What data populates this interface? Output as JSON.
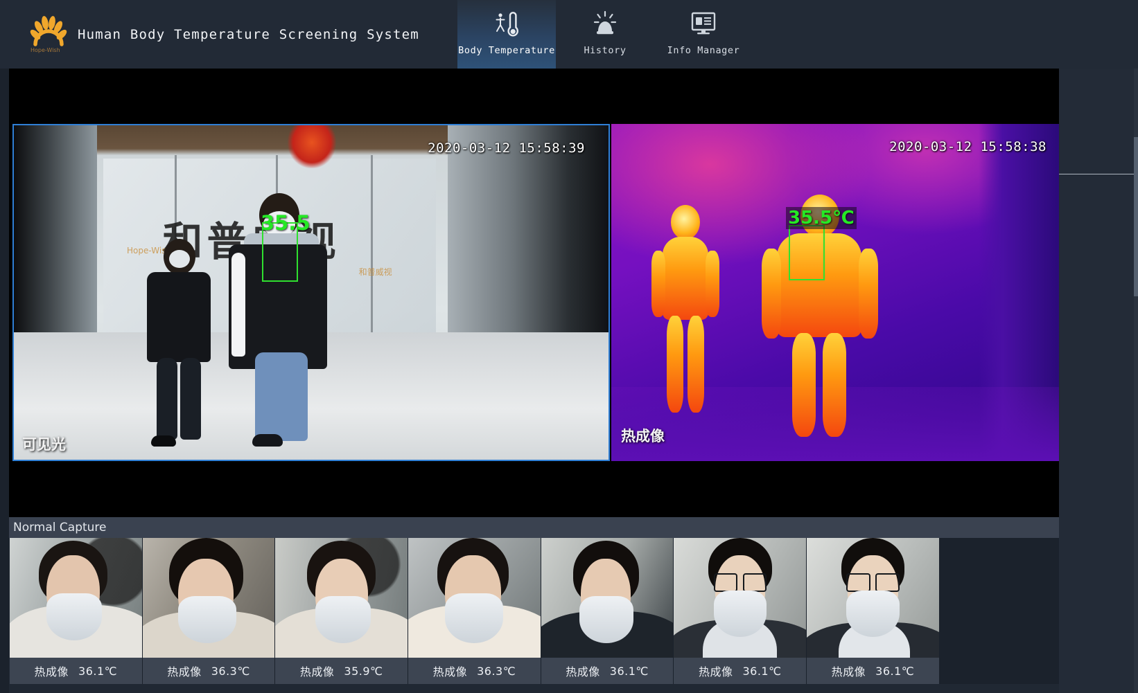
{
  "app": {
    "title": "Human Body Temperature Screening System",
    "logo_name": "hope-wish-sunflower-logo",
    "logo_subtext": "Hope-Wish",
    "background_color": "#202833",
    "header_color": "#222a36"
  },
  "nav": {
    "items": [
      {
        "id": "body-temperature",
        "label": "Body Temperature",
        "icon": "thermometer-person-icon",
        "active": true
      },
      {
        "id": "history",
        "label": "History",
        "icon": "alarm-bell-icon",
        "active": false
      },
      {
        "id": "info-manager",
        "label": "Info Manager",
        "icon": "monitor-info-icon",
        "active": false
      }
    ],
    "active_tab_color": "#2e5278"
  },
  "video": {
    "left": {
      "name": "visible-light-camera",
      "timestamp": "2020-03-12 15:58:39",
      "corner_label": "可见光",
      "border_color": "#2f7fd6",
      "detection": {
        "temperature": "35.5",
        "box_color": "#2fe02f",
        "text_color": "#25e825"
      }
    },
    "right": {
      "name": "thermal-camera",
      "timestamp": "2020-03-12 15:58:38",
      "corner_label": "热成像",
      "detection": {
        "temperature": "35.5℃",
        "box_color": "#2fe02f",
        "text_color": "#25e825"
      }
    }
  },
  "capture": {
    "header": "Normal Capture",
    "items": [
      {
        "label": "热成像",
        "temperature": "36.1℃"
      },
      {
        "label": "热成像",
        "temperature": "36.3℃"
      },
      {
        "label": "热成像",
        "temperature": "35.9℃"
      },
      {
        "label": "热成像",
        "temperature": "36.3℃"
      },
      {
        "label": "热成像",
        "temperature": "36.1℃"
      },
      {
        "label": "热成像",
        "temperature": "36.1℃"
      },
      {
        "label": "热成像",
        "temperature": "36.1℃"
      }
    ]
  }
}
